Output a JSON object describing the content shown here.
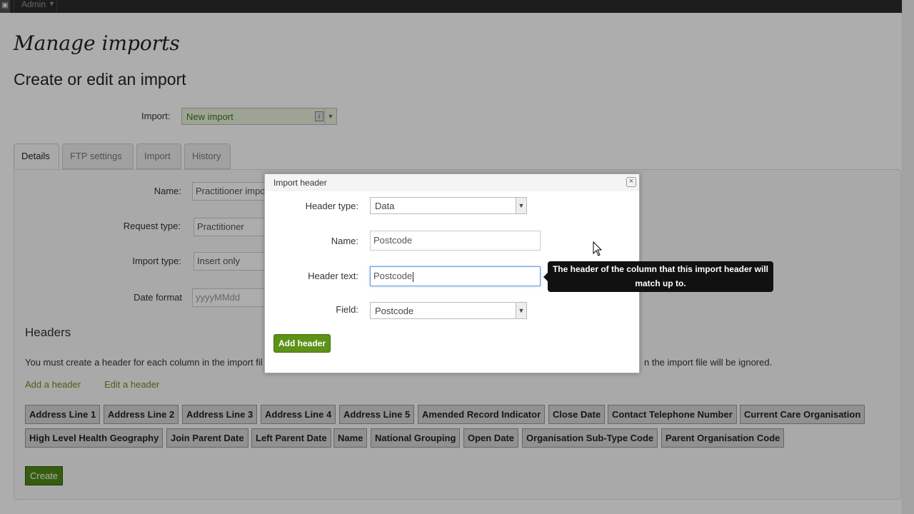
{
  "topbar": {
    "menu_label": "Admin",
    "corner_icon": "window-icon"
  },
  "page": {
    "title": "Manage imports",
    "subtitle": "Create or edit an import",
    "import_label": "Import:",
    "import_value": "New import"
  },
  "tabs": [
    {
      "label": "Details",
      "active": true
    },
    {
      "label": "FTP settings",
      "active": false
    },
    {
      "label": "Import",
      "active": false
    },
    {
      "label": "History",
      "active": false
    }
  ],
  "form": {
    "name_label": "Name:",
    "name_value": "Practitioner import",
    "request_type_label": "Request type:",
    "request_type_value": "Practitioner",
    "import_type_label": "Import type:",
    "import_type_value": "Insert only",
    "date_format_label": "Date format",
    "date_format_placeholder": "yyyyMMdd"
  },
  "headers": {
    "heading": "Headers",
    "note_left": "You must create a header for each column in the import fil",
    "note_right": "n the import file will be ignored.",
    "add_link": "Add a header",
    "edit_link": "Edit a header",
    "chips": [
      "Address Line 1",
      "Address Line 2",
      "Address Line 3",
      "Address Line 4",
      "Address Line 5",
      "Amended Record Indicator",
      "Close Date",
      "Contact Telephone Number",
      "Current Care Organisation",
      "High Level Health Geography",
      "Join Parent Date",
      "Left Parent Date",
      "Name",
      "National Grouping",
      "Open Date",
      "Organisation Sub-Type Code",
      "Parent Organisation Code"
    ],
    "create_button": "Create"
  },
  "dialog": {
    "title": "Import header",
    "header_type_label": "Header type:",
    "header_type_value": "Data",
    "name_label": "Name:",
    "name_value": "Postcode",
    "header_text_label": "Header text:",
    "header_text_value": "Postcode",
    "field_label": "Field:",
    "field_value": "Postcode",
    "add_button": "Add header"
  },
  "tooltip": {
    "line1": "The header of the column that this import header will",
    "line2": "match up to."
  },
  "colors": {
    "accent_green": "#5d9217",
    "link_green": "#6a8e1a",
    "topbar": "#2b2b2b"
  }
}
